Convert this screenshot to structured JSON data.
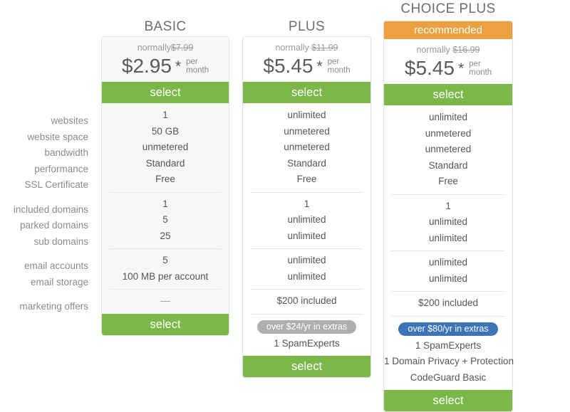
{
  "colors": {
    "green": "#7ab84a",
    "orange": "#eda03f",
    "blue": "#3d74b8",
    "gray_pill": "#aeaeae",
    "card_bg_basic": "#f7f7f7",
    "text": "#666666"
  },
  "feature_labels": {
    "group1": [
      "websites",
      "website space",
      "bandwidth",
      "performance",
      "SSL Certificate"
    ],
    "group2": [
      "included domains",
      "parked domains",
      "sub domains"
    ],
    "group3": [
      "email accounts",
      "email storage"
    ],
    "group4": [
      "marketing offers"
    ]
  },
  "plans": [
    {
      "id": "basic",
      "title": "BASIC",
      "ribbon": null,
      "normally_prefix": "normally",
      "normally_price": "$7.99",
      "price": "$2.95",
      "star": "*",
      "per": "per",
      "month": "month",
      "select_top": "select",
      "select_bottom": "select",
      "group1": [
        "1",
        "50 GB",
        "unmetered",
        "Standard",
        "Free"
      ],
      "group2": [
        "1",
        "5",
        "25"
      ],
      "group3": [
        "5",
        "100 MB per account"
      ],
      "group4": [
        "—"
      ],
      "extras_pill": null,
      "extras": []
    },
    {
      "id": "plus",
      "title": "PLUS",
      "ribbon": null,
      "normally_prefix": "normally",
      "normally_price": "$11.99",
      "price": "$5.45",
      "star": "*",
      "per": "per",
      "month": "month",
      "select_top": "select",
      "select_bottom": "select",
      "group1": [
        "unlimited",
        "unmetered",
        "unmetered",
        "Standard",
        "Free"
      ],
      "group2": [
        "1",
        "unlimited",
        "unlimited"
      ],
      "group3": [
        "unlimited",
        "unlimited"
      ],
      "group4": [
        "$200 included"
      ],
      "extras_pill": "over $24/yr in extras",
      "extras": [
        "1 SpamExperts"
      ]
    },
    {
      "id": "choice",
      "title": "CHOICE PLUS",
      "ribbon": "recommended",
      "normally_prefix": "normally",
      "normally_price": "$16.99",
      "price": "$5.45",
      "star": "*",
      "per": "per",
      "month": "month",
      "select_top": "select",
      "select_bottom": "select",
      "group1": [
        "unlimited",
        "unmetered",
        "unmetered",
        "Standard",
        "Free"
      ],
      "group2": [
        "1",
        "unlimited",
        "unlimited"
      ],
      "group3": [
        "unlimited",
        "unlimited"
      ],
      "group4": [
        "$200 included"
      ],
      "extras_pill": "over $80/yr in extras",
      "extras": [
        "1 SpamExperts",
        "1 Domain Privacy + Protection",
        "CodeGuard Basic"
      ]
    }
  ]
}
